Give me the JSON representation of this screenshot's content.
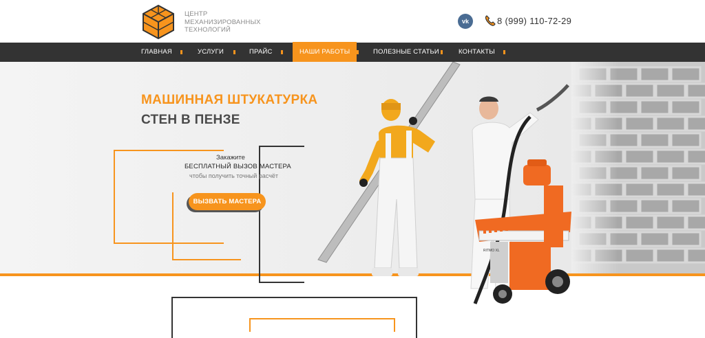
{
  "header": {
    "logo_lines": [
      "ЦЕНТР",
      "МЕХАНИЗИРОВАННЫХ",
      "ТЕХНОЛОГИЙ"
    ],
    "vk_label": "vk",
    "phone": "8 (999) 110-72-29"
  },
  "nav": {
    "items": [
      {
        "label": "ГЛАВНАЯ"
      },
      {
        "label": "УСЛУГИ"
      },
      {
        "label": "ПРАЙС"
      },
      {
        "label": "НАШИ РАБОТЫ"
      },
      {
        "label": "ПОЛЕЗНЫЕ СТАТЬИ"
      },
      {
        "label": "КОНТАКТЫ"
      }
    ],
    "active_index": 3
  },
  "hero": {
    "title_line1": "МАШИННАЯ ШТУКАТУРКА",
    "title_line2": "СТЕН В ПЕНЗЕ",
    "cta_line1": "Закажите",
    "cta_line2": "БЕСПЛАТНЫЙ ВЫЗОВ МАСТЕРА",
    "cta_line3": "чтобы получить точный расчёт",
    "cta_button": "ВЫЗВАТЬ МАСТЕРА",
    "machine_label": "RITMO XL"
  },
  "colors": {
    "accent": "#f7941d",
    "nav_bg": "#333333",
    "title_dark": "#4a4a4a",
    "vk": "#4a6c93"
  },
  "icons": [
    "logo-cube-icon",
    "vk-icon",
    "phone-icon"
  ]
}
